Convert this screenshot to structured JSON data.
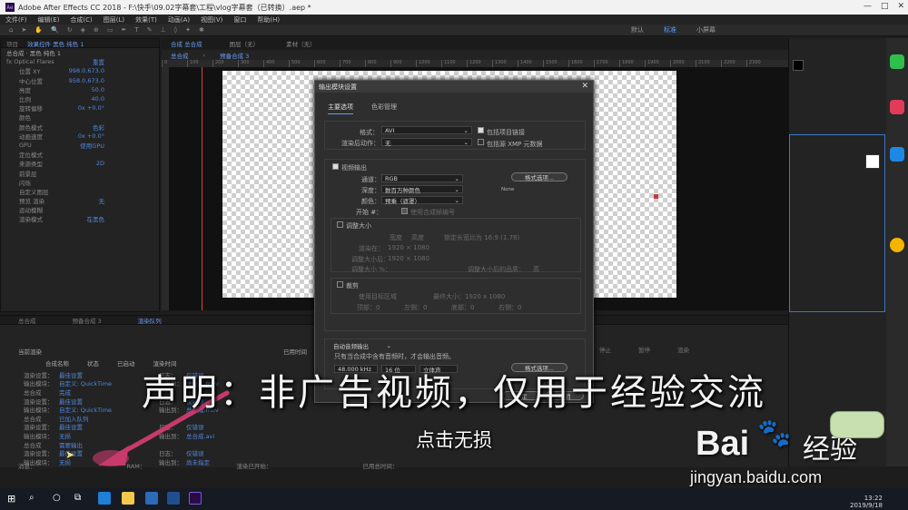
{
  "window": {
    "title": "Adobe After Effects CC 2018 - F:\\快手\\09.02字幕套\\工程\\vlog字幕套（已转换）.aep *",
    "app_icon": "Ae",
    "minimize": "—",
    "maximize": "□",
    "close": "✕"
  },
  "menubar": [
    "文件(F)",
    "编辑(E)",
    "合成(C)",
    "图层(L)",
    "效果(T)",
    "动画(A)",
    "视图(V)",
    "窗口",
    "帮助(H)"
  ],
  "workspaces": [
    "默认",
    "标准",
    "小屏幕"
  ],
  "left_panel": {
    "tabs": [
      "项目",
      "效果控件 黑色 纯色 1"
    ],
    "header": "总合成 · 黑色 纯色 1",
    "props": [
      {
        "label": "fx Optical Flares",
        "value": "重置"
      },
      {
        "label": "位置 XY",
        "value": "998.0,673.0"
      },
      {
        "label": "中心位置",
        "value": "958.0,673.0"
      },
      {
        "label": "亮度",
        "value": "50.0"
      },
      {
        "label": "比例",
        "value": "40.0"
      },
      {
        "label": "旋转偏移",
        "value": "0x +0.0°"
      },
      {
        "label": "颜色",
        "value": ""
      },
      {
        "label": "颜色模式",
        "value": "色彩"
      },
      {
        "label": "动画速度",
        "value": "0x +0.0°"
      },
      {
        "label": "GPU",
        "value": "使用GPU"
      },
      {
        "label": "定位模式",
        "value": ""
      },
      {
        "label": "来源类型",
        "value": "2D"
      },
      {
        "label": "前景层",
        "value": ""
      },
      {
        "label": "闪烁",
        "value": ""
      },
      {
        "label": "自定义图层",
        "value": ""
      },
      {
        "label": "预览 渲染",
        "value": "无"
      },
      {
        "label": "运动模糊",
        "value": ""
      },
      {
        "label": "渲染模式",
        "value": "在黑色"
      }
    ]
  },
  "comp_panel": {
    "tabs": [
      "合成 总合成",
      "图层（无）",
      "素材（无）"
    ],
    "subtabs": [
      "总合成",
      "预备合成 3"
    ],
    "ruler": [
      "0",
      "100",
      "200",
      "300",
      "400",
      "500",
      "600",
      "700",
      "800",
      "900",
      "1000",
      "1100",
      "1200",
      "1300",
      "1400",
      "1500",
      "1600",
      "1700",
      "1800",
      "1900",
      "2000",
      "2100",
      "2200",
      "2300"
    ]
  },
  "dialog": {
    "title": "输出模块设置",
    "tabs": [
      "主要选项",
      "色彩管理"
    ],
    "format_label": "格式：",
    "format_value": "AVI",
    "include_project_link": "包括项目链接",
    "post_render_label": "渲染后动作：",
    "post_render_value": "无",
    "include_xmp": "包括源 XMP 元数据",
    "video_output": "视频输出",
    "channel_label": "通道：",
    "channel_value": "RGB",
    "format_options_btn": "格式选项...",
    "depth_label": "深度：",
    "depth_value": "数百万种颜色",
    "color_label": "颜色：",
    "color_value": "预乘（遮罩）",
    "none_text": "None",
    "start_label": "开始 #：",
    "use_comp_frame": "使用合成帧编号",
    "resize": "调整大小",
    "resize_cols": [
      "宽度",
      "高度"
    ],
    "lock_ratio": "锁定长宽比为 16:9 (1.78)",
    "render_size_label": "渲染在：",
    "render_size": "1920 × 1080",
    "resize_to_label": "调整大小后：",
    "resize_to": "1920 × 1080",
    "resize_pct_label": "调整大小 %：",
    "resize_quality": "调整大小后的品质：",
    "resize_quality_value": "高",
    "crop": "裁剪",
    "use_roi": "使用目标区域",
    "final_size": "最终大小：1920 x 1080",
    "crop_fields": [
      "顶部：0",
      "左侧：0",
      "底部：0",
      "右侧：0"
    ],
    "audio_label": "自动音频输出",
    "audio_note": "只有当合成中含有音频时，才会输出音频。",
    "audio_rate": "48.000 kHz",
    "audio_bits": "16 位",
    "audio_ch": "立体声",
    "audio_format_btn": "格式选项...",
    "ok_btn": "确定",
    "cancel_btn": "取消"
  },
  "render_queue": {
    "tabs": [
      "总合成",
      "预备合成 3",
      "渲染队列"
    ],
    "current_render": "当前渲染",
    "elapsed": "已用时间",
    "cols": [
      "渲染",
      "合成名称",
      "状态",
      "已启动",
      "渲染时间"
    ],
    "rows": [
      {
        "label": "渲染设置：",
        "value": "最佳设置",
        "extra": "日志：",
        "extra2": "仅错误"
      },
      {
        "label": "输出模块：",
        "value": "自定义: QuickTime",
        "extra": "输出到：",
        "extra2": "总合成.mov"
      },
      {
        "label": "总合成",
        "value": "完成",
        "extra": "",
        "extra2": ""
      },
      {
        "label": "渲染设置：",
        "value": "最佳设置",
        "extra": "日志：",
        "extra2": "仅错误"
      },
      {
        "label": "输出模块：",
        "value": "自定义: QuickTime",
        "extra": "输出到：",
        "extra2": "总合成.mov"
      },
      {
        "label": "总合成",
        "value": "已加入队列",
        "extra": "",
        "extra2": ""
      },
      {
        "label": "渲染设置：",
        "value": "最佳设置",
        "extra": "日志：",
        "extra2": "仅错误"
      },
      {
        "label": "输出模块：",
        "value": "无损",
        "extra": "输出到：",
        "extra2": "总合成.avi"
      },
      {
        "label": "总合成",
        "value": "需要输出",
        "extra": "",
        "extra2": ""
      },
      {
        "label": "渲染设置：",
        "value": "最佳设置",
        "extra": "日志：",
        "extra2": "仅错误"
      },
      {
        "label": "输出模块：",
        "value": "无损",
        "extra": "输出到：",
        "extra2": "尚未指定"
      }
    ],
    "footer": [
      "消息：",
      "RAM：",
      "渲染已开始：",
      "已用总时间："
    ],
    "btns": [
      "停止",
      "暂停",
      "渲染"
    ]
  },
  "overlay": {
    "disclaimer": "声明：非广告视频，仅用于经验交流",
    "caption": "点击无损"
  },
  "watermark": {
    "brand": "Bai",
    "brand2": "经验",
    "url": "jingyan.baidu.com"
  },
  "taskbar": {
    "time": "13:22",
    "date": "2019/9/18"
  },
  "colors": {
    "accent": "#4f87e0",
    "red_line": "#e04040",
    "pink_arrow": "#c83a6c"
  }
}
